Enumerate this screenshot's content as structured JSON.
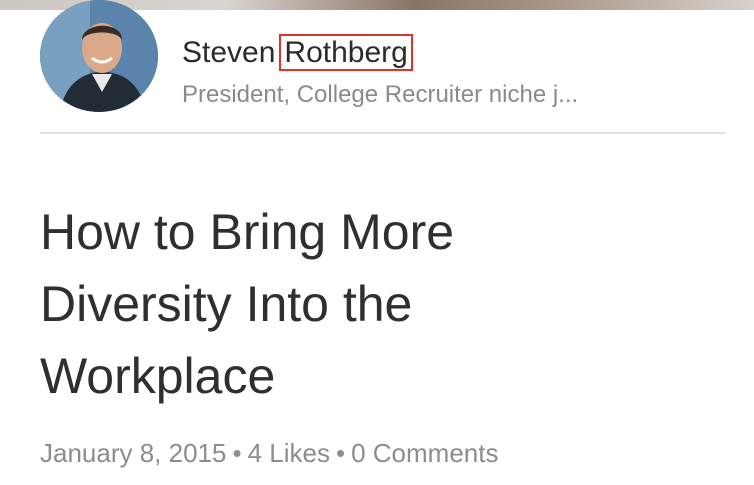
{
  "author": {
    "first_name": "Steven",
    "last_name": "Rothberg",
    "title": "President, College Recruiter niche j..."
  },
  "article": {
    "headline_lines": [
      "How to Bring More",
      "Diversity Into the",
      "Workplace"
    ],
    "date": "January 8, 2015",
    "separator": "•",
    "likes": "4 Likes",
    "comments": "0 Comments"
  },
  "colors": {
    "highlight_box": "#e0322c",
    "divider": "#e3e3e3",
    "meta_text": "#8c8c8c"
  }
}
